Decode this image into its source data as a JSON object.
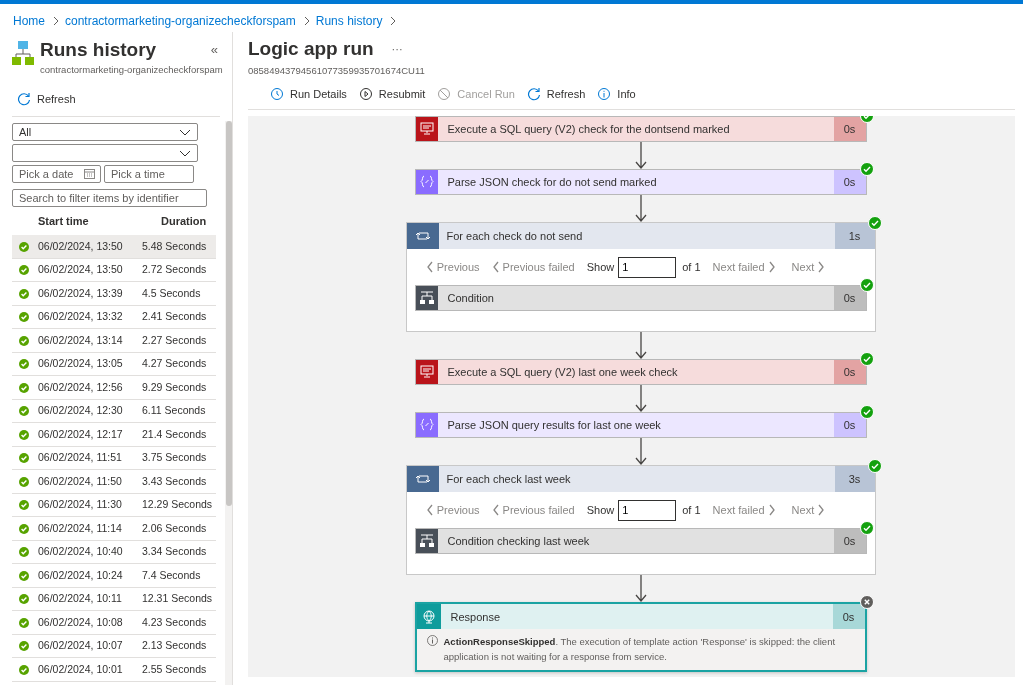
{
  "breadcrumb": [
    "Home",
    "contractormarketing-organizecheckforspam",
    "Runs history"
  ],
  "runs_panel": {
    "title": "Runs history",
    "subtitle": "contractormarketing-organizecheckforspam",
    "collapse": "«",
    "refresh": "Refresh",
    "status_filter": {
      "value": "All"
    },
    "date": {
      "placeholder": "Pick a date"
    },
    "time": {
      "placeholder": "Pick a time"
    },
    "search": {
      "placeholder": "Search to filter items by identifier"
    },
    "columns": [
      "Start time",
      "Duration"
    ],
    "runs": [
      {
        "start": "06/02/2024, 13:50",
        "duration": "5.48 Seconds",
        "selected": true
      },
      {
        "start": "06/02/2024, 13:50",
        "duration": "2.72 Seconds",
        "selected": false
      },
      {
        "start": "06/02/2024, 13:39",
        "duration": "4.5 Seconds",
        "selected": false
      },
      {
        "start": "06/02/2024, 13:32",
        "duration": "2.41 Seconds",
        "selected": false
      },
      {
        "start": "06/02/2024, 13:14",
        "duration": "2.27 Seconds",
        "selected": false
      },
      {
        "start": "06/02/2024, 13:05",
        "duration": "4.27 Seconds",
        "selected": false
      },
      {
        "start": "06/02/2024, 12:56",
        "duration": "9.29 Seconds",
        "selected": false
      },
      {
        "start": "06/02/2024, 12:30",
        "duration": "6.11 Seconds",
        "selected": false
      },
      {
        "start": "06/02/2024, 12:17",
        "duration": "21.4 Seconds",
        "selected": false
      },
      {
        "start": "06/02/2024, 11:51",
        "duration": "3.75 Seconds",
        "selected": false
      },
      {
        "start": "06/02/2024, 11:50",
        "duration": "3.43 Seconds",
        "selected": false
      },
      {
        "start": "06/02/2024, 11:30",
        "duration": "12.29 Seconds",
        "selected": false
      },
      {
        "start": "06/02/2024, 11:14",
        "duration": "2.06 Seconds",
        "selected": false
      },
      {
        "start": "06/02/2024, 10:40",
        "duration": "3.34 Seconds",
        "selected": false
      },
      {
        "start": "06/02/2024, 10:24",
        "duration": "7.4 Seconds",
        "selected": false
      },
      {
        "start": "06/02/2024, 10:11",
        "duration": "12.31 Seconds",
        "selected": false
      },
      {
        "start": "06/02/2024, 10:08",
        "duration": "4.23 Seconds",
        "selected": false
      },
      {
        "start": "06/02/2024, 10:07",
        "duration": "2.13 Seconds",
        "selected": false
      },
      {
        "start": "06/02/2024, 10:01",
        "duration": "2.55 Seconds",
        "selected": false
      }
    ]
  },
  "run": {
    "title": "Logic app run",
    "more": "···",
    "run_id": "08584943794561077359935701674CU11",
    "toolbar": [
      {
        "kind": "history",
        "label": "Run Details",
        "disabled": false
      },
      {
        "kind": "resubmit",
        "label": "Resubmit",
        "disabled": false
      },
      {
        "kind": "cancel",
        "label": "Cancel Run",
        "disabled": true
      },
      {
        "kind": "refresh",
        "label": "Refresh",
        "disabled": false
      },
      {
        "kind": "info",
        "label": "Info",
        "disabled": false
      }
    ],
    "steps": [
      {
        "kind": "sql",
        "title": "Execute a SQL query (V2) check for the dontsend marked",
        "duration": "0s",
        "succeeded": true
      },
      {
        "kind": "parse",
        "title": "Parse JSON check for do not send marked",
        "duration": "0s",
        "succeeded": true
      },
      {
        "kind": "foreach",
        "title": "For each check do not send",
        "duration": "1s",
        "succeeded": true,
        "pager": {
          "previous": "Previous",
          "previous_failed": "Previous failed",
          "show": "Show",
          "value": "1",
          "of": "of 1",
          "next_failed": "Next failed",
          "next": "Next"
        },
        "children": [
          {
            "kind": "condition",
            "title": "Condition",
            "duration": "0s",
            "succeeded": true
          }
        ]
      },
      {
        "kind": "sql",
        "title": "Execute a SQL query (V2) last one week check",
        "duration": "0s",
        "succeeded": true
      },
      {
        "kind": "parse",
        "title": "Parse JSON query results for last one week",
        "duration": "0s",
        "succeeded": true
      },
      {
        "kind": "foreach",
        "title": "For each check last week",
        "duration": "3s",
        "succeeded": true,
        "pager": {
          "previous": "Previous",
          "previous_failed": "Previous failed",
          "show": "Show",
          "value": "1",
          "of": "of 1",
          "next_failed": "Next failed",
          "next": "Next"
        },
        "children": [
          {
            "kind": "condition",
            "title": "Condition checking last week",
            "duration": "0s",
            "succeeded": true
          }
        ]
      },
      {
        "kind": "response",
        "title": "Response",
        "duration": "0s",
        "succeeded": false,
        "message": "**ActionResponseSkipped**. The execution of template action 'Response' is skipped: the client application is not waiting for a response from service."
      }
    ]
  }
}
